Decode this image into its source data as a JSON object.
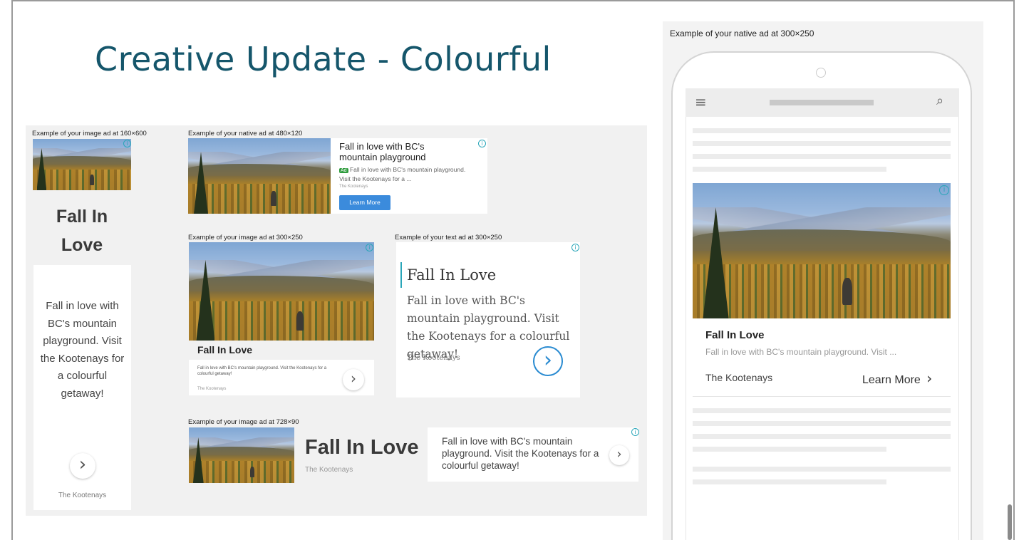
{
  "slide": {
    "title": "Creative Update - Colourful"
  },
  "captions": {
    "image_160x600": "Example of your image ad at 160×600",
    "native_480x120": "Example of your native ad at 480×120",
    "image_300x250": "Example of your image ad at 300×250",
    "text_300x250": "Example of your text ad at 300×250",
    "image_728x90": "Example of your image ad at 728×90",
    "native_300x250": "Example of your native ad at 300×250"
  },
  "ad": {
    "headline_title": "Fall In Love",
    "headline_split_1": "Fall In",
    "headline_split_2": "Love",
    "advertiser": "The Kootenays",
    "description": "Fall in love with BC's mountain playground. Visit the Kootenays for a colourful getaway!",
    "tall_desc": "Fall in love with BC's mountain playground. Visit the Kootenays for a colourful getaway!",
    "native_headline": "Fall in love with BC's mountain playground",
    "native_badge": "Ad",
    "native_desc": "Fall in love with BC's mountain playground. Visit the Kootenays for a ...",
    "native_cta": "Learn More",
    "small_desc": "Fall in love with BC's mountain playground. Visit the Kootenays for a colourful getaway!",
    "phone_desc": "Fall in love with BC's mountain playground. Visit ...",
    "phone_cta": "Learn More",
    "info_glyph": "i",
    "chevron": "›"
  },
  "icons": {
    "menu": "≡",
    "search": "⌕"
  },
  "colors": {
    "title": "#15566b",
    "accent": "#2aa6b9",
    "cta_blue": "#3b8bdc",
    "ad_badge": "#2e9b3c"
  }
}
